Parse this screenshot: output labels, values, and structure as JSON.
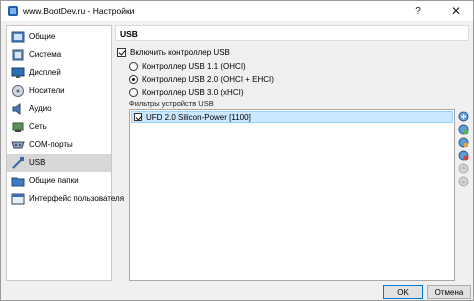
{
  "window": {
    "title": "www.BootDev.ru - Настройки",
    "help_glyph": "?",
    "close_glyph": "✕"
  },
  "sidebar": {
    "items": [
      {
        "label": "Общие",
        "icon": "general-icon"
      },
      {
        "label": "Система",
        "icon": "system-icon"
      },
      {
        "label": "Дисплей",
        "icon": "display-icon"
      },
      {
        "label": "Носители",
        "icon": "storage-icon"
      },
      {
        "label": "Аудио",
        "icon": "audio-icon"
      },
      {
        "label": "Сеть",
        "icon": "network-icon"
      },
      {
        "label": "COM-порты",
        "icon": "serial-ports-icon"
      },
      {
        "label": "USB",
        "icon": "usb-icon",
        "selected": true
      },
      {
        "label": "Общие папки",
        "icon": "shared-folders-icon"
      },
      {
        "label": "Интерфейс пользователя",
        "icon": "user-interface-icon"
      }
    ]
  },
  "usb": {
    "section_title": "USB",
    "enable_label": "Включить контроллер USB",
    "enable_checked": true,
    "controllers": [
      {
        "label": "Контроллер USB 1.1 (OHCI)",
        "selected": false
      },
      {
        "label": "Контроллер USB 2.0 (OHCI + EHCI)",
        "selected": true
      },
      {
        "label": "Контроллер USB 3.0 (xHCI)",
        "selected": false
      }
    ],
    "filters_label": "Фильтры устройств USB",
    "filters": [
      {
        "label": "UFD 2.0 Silicon-Power [1100]",
        "checked": true
      }
    ]
  },
  "footer": {
    "ok_label": "OK",
    "cancel_label": "Отмена"
  },
  "colors": {
    "selection": "#cce8ff",
    "sidebar_selected": "#d7d7d7",
    "ok_border": "#0078d7"
  }
}
